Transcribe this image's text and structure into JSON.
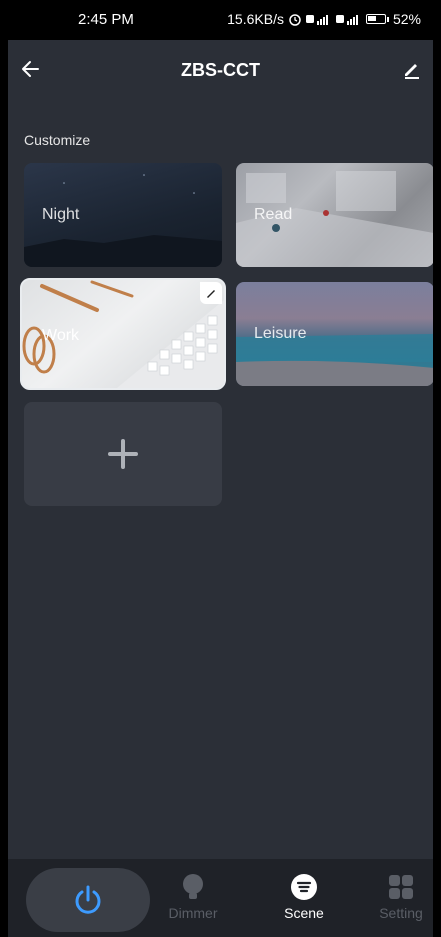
{
  "status_bar": {
    "time": "2:45 PM",
    "network_speed": "15.6KB/s",
    "battery_percent": "52%",
    "battery_level": 0.52
  },
  "header": {
    "title": "ZBS-CCT",
    "back_icon": "arrow-left-icon",
    "edit_icon": "pencil-icon"
  },
  "section": {
    "title": "Customize"
  },
  "scenes": [
    {
      "label": "Night",
      "selected": false
    },
    {
      "label": "Read",
      "selected": false
    },
    {
      "label": "Work",
      "selected": true
    },
    {
      "label": "Leisure",
      "selected": false
    }
  ],
  "add_scene": {
    "icon": "plus-icon"
  },
  "bottom_nav": {
    "power_icon": "power-icon",
    "tabs": [
      {
        "label": "Dimmer",
        "icon": "bulb-icon",
        "active": false
      },
      {
        "label": "Scene",
        "icon": "scene-icon",
        "active": true
      },
      {
        "label": "Setting",
        "icon": "grid-icon",
        "active": false
      }
    ]
  },
  "colors": {
    "background": "#2b2f37",
    "accent": "#3d9bff",
    "nav_background": "#1f2228"
  }
}
